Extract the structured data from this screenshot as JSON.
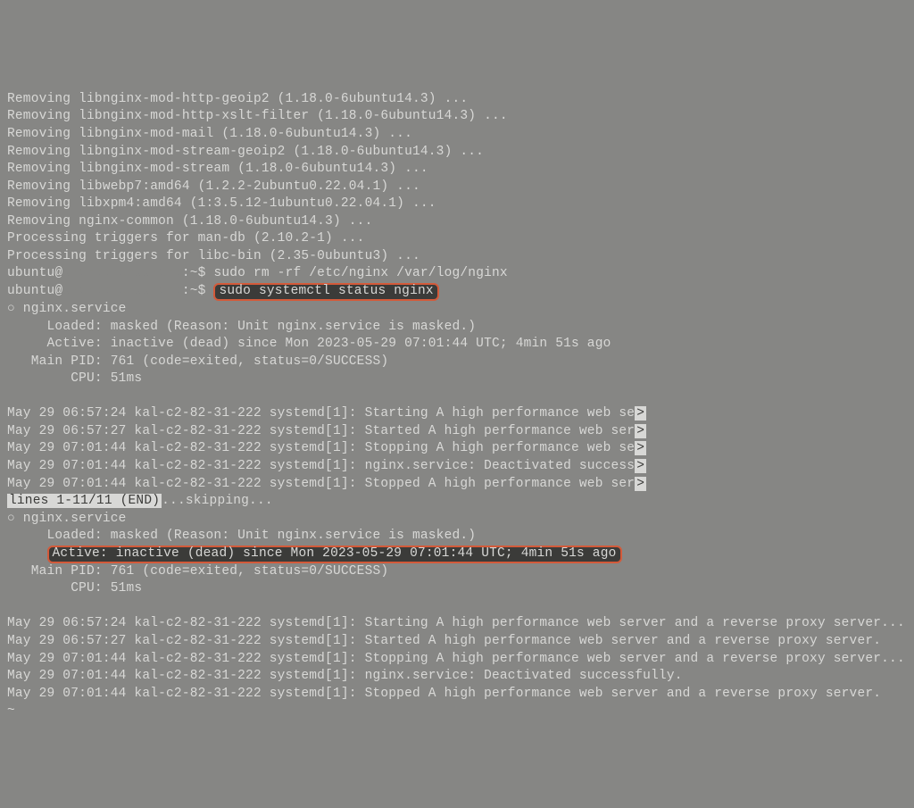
{
  "removing_lines": [
    "Removing libnginx-mod-http-geoip2 (1.18.0-6ubuntu14.3) ...",
    "Removing libnginx-mod-http-xslt-filter (1.18.0-6ubuntu14.3) ...",
    "Removing libnginx-mod-mail (1.18.0-6ubuntu14.3) ...",
    "Removing libnginx-mod-stream-geoip2 (1.18.0-6ubuntu14.3) ...",
    "Removing libnginx-mod-stream (1.18.0-6ubuntu14.3) ...",
    "Removing libwebp7:amd64 (1.2.2-2ubuntu0.22.04.1) ...",
    "Removing libxpm4:amd64 (1:3.5.12-1ubuntu0.22.04.1) ...",
    "Removing nginx-common (1.18.0-6ubuntu14.3) ...",
    "Processing triggers for man-db (2.10.2-1) ...",
    "Processing triggers for libc-bin (2.35-0ubuntu3) ..."
  ],
  "prompt_user": "ubuntu@",
  "prompt_tail": ":~$ ",
  "command1": "sudo rm -rf /etc/nginx /var/log/nginx",
  "command2": "sudo systemctl status nginx",
  "status_block1": {
    "header": "○ nginx.service",
    "loaded": "     Loaded: masked (Reason: Unit nginx.service is masked.)",
    "active": "     Active: inactive (dead) since Mon 2023-05-29 07:01:44 UTC; 4min 51s ago",
    "mainpid": "   Main PID: 761 (code=exited, status=0/SUCCESS)",
    "cpu": "        CPU: 51ms"
  },
  "journal_short": [
    "May 29 06:57:24 kal-c2-82-31-222 systemd[1]: Starting A high performance web se",
    "May 29 06:57:27 kal-c2-82-31-222 systemd[1]: Started A high performance web ser",
    "May 29 07:01:44 kal-c2-82-31-222 systemd[1]: Stopping A high performance web se",
    "May 29 07:01:44 kal-c2-82-31-222 systemd[1]: nginx.service: Deactivated success",
    "May 29 07:01:44 kal-c2-82-31-222 systemd[1]: Stopped A high performance web ser"
  ],
  "pager_line_prefix": "lines 1-11/11 (END)",
  "pager_line_suffix": "...skipping...",
  "status_block2": {
    "header": "○ nginx.service",
    "loaded": "     Loaded: masked (Reason: Unit nginx.service is masked.)",
    "active_indent": "     ",
    "active_text": "Active: inactive (dead) since Mon 2023-05-29 07:01:44 UTC; 4min 51s ago",
    "mainpid": "   Main PID: 761 (code=exited, status=0/SUCCESS)",
    "cpu": "        CPU: 51ms"
  },
  "journal_full": [
    "May 29 06:57:24 kal-c2-82-31-222 systemd[1]: Starting A high performance web server and a reverse proxy server...",
    "May 29 06:57:27 kal-c2-82-31-222 systemd[1]: Started A high performance web server and a reverse proxy server.",
    "May 29 07:01:44 kal-c2-82-31-222 systemd[1]: Stopping A high performance web server and a reverse proxy server...",
    "May 29 07:01:44 kal-c2-82-31-222 systemd[1]: nginx.service: Deactivated successfully.",
    "May 29 07:01:44 kal-c2-82-31-222 systemd[1]: Stopped A high performance web server and a reverse proxy server."
  ],
  "tilde": "~",
  "arrow": ">"
}
